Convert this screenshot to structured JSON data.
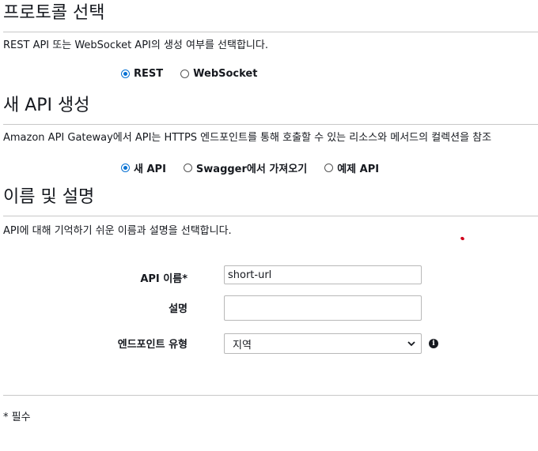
{
  "protocol_section": {
    "title": "프로토콜 선택",
    "description": "REST API 또는 WebSocket API의 생성 여부를 선택합니다.",
    "options": [
      {
        "label": "REST",
        "checked": true
      },
      {
        "label": "WebSocket",
        "checked": false
      }
    ]
  },
  "new_api_section": {
    "title": "새 API 생성",
    "description": "Amazon API Gateway에서 API는 HTTPS 엔드포인트를 통해 호출할 수 있는 리소스와 메서드의 컬렉션을 참조",
    "options": [
      {
        "label": "새 API",
        "checked": true
      },
      {
        "label": "Swagger에서 가져오기",
        "checked": false
      },
      {
        "label": "예제 API",
        "checked": false
      }
    ]
  },
  "name_section": {
    "title": "이름 및 설명",
    "description": "API에 대해 기억하기 쉬운 이름과 설명을 선택합니다."
  },
  "form": {
    "api_name_label": "API 이름*",
    "api_name_value": "short-url",
    "description_label": "설명",
    "description_value": "",
    "endpoint_type_label": "엔드포인트 유형",
    "endpoint_type_value": "지역"
  },
  "footer": {
    "required_note": "* 필수"
  },
  "colors": {
    "radio_accent": "#0972d3",
    "text": "#16191f",
    "rule": "#c8c8c8"
  },
  "icons": {
    "info": "info-icon",
    "select_chevron": "chevron-down-icon"
  }
}
